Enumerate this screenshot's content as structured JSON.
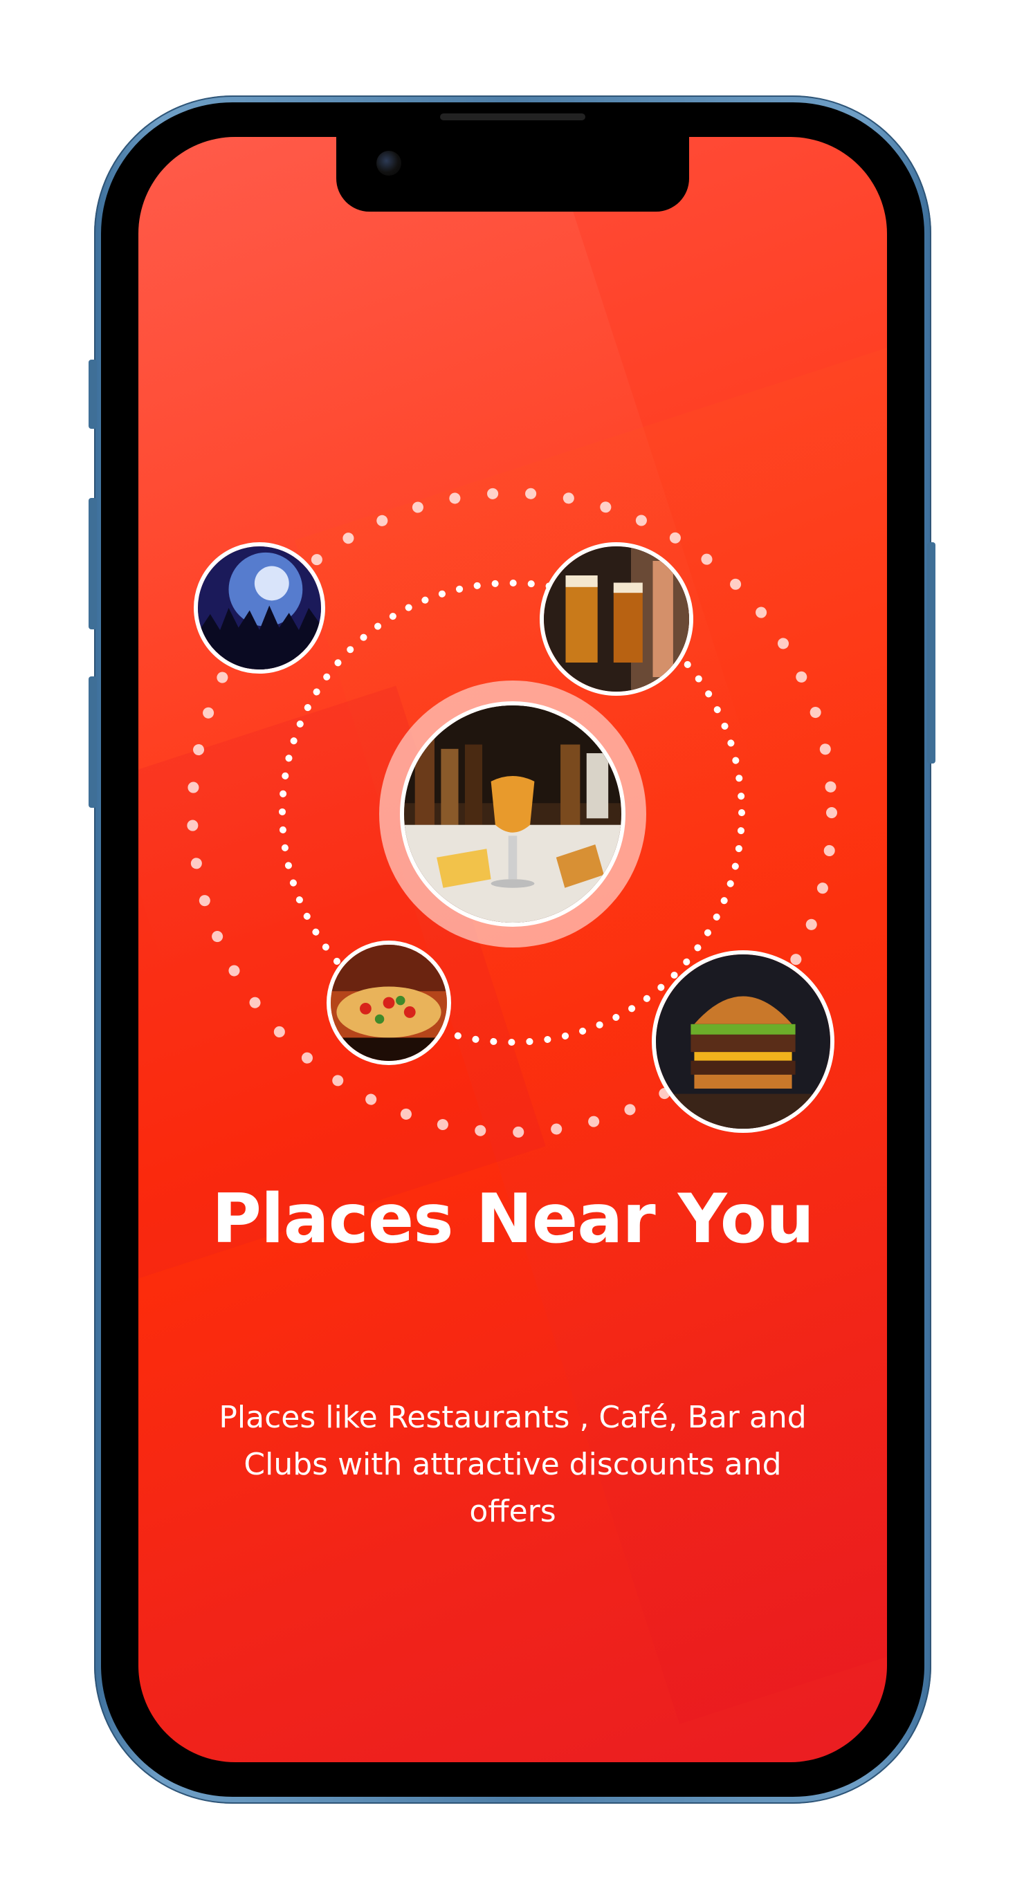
{
  "onboarding": {
    "title": "Places Near You",
    "description": "Places like Restaurants , Café, Bar and Clubs with attractive discounts and offers"
  },
  "images": {
    "center": "beer-and-fries-photo",
    "top_left": "concert-crowd-photo",
    "top_right": "beer-glasses-photo",
    "bottom_left": "pizza-photo",
    "bottom_right": "burger-photo"
  },
  "colors": {
    "background_primary": "#ff3a1a",
    "background_secondary": "#ea1d22",
    "text": "#ffffff",
    "phone_frame": "#4f7fa8"
  }
}
